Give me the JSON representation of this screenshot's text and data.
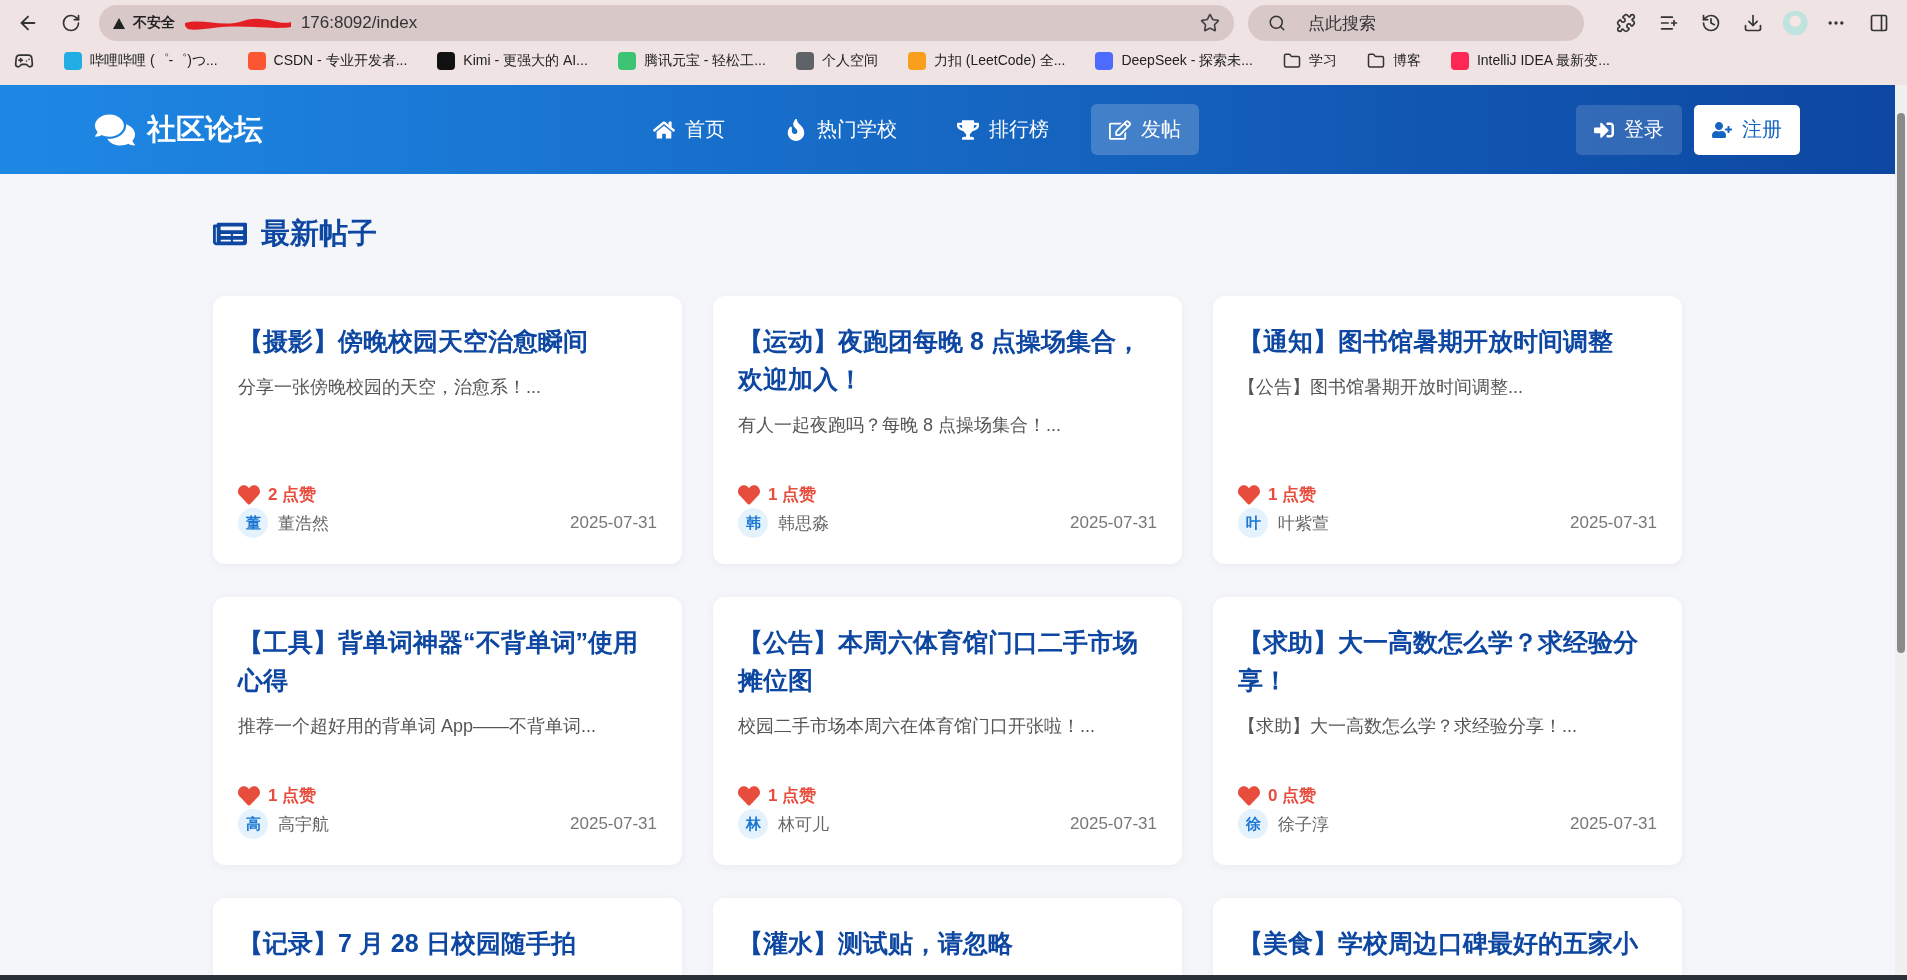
{
  "browser": {
    "security_label": "不安全",
    "url": "176:8092/index",
    "search_placeholder": "点此搜索",
    "bookmarks": [
      {
        "label": "哔哩哔哩 (゜-゜)つ...",
        "kind": "site",
        "color": "#23ade5"
      },
      {
        "label": "CSDN - 专业开发者...",
        "kind": "site",
        "color": "#fc5531"
      },
      {
        "label": "Kimi - 更强大的 AI...",
        "kind": "site",
        "color": "#111111"
      },
      {
        "label": "腾讯元宝 - 轻松工...",
        "kind": "site",
        "color": "#3cc474"
      },
      {
        "label": "个人空间",
        "kind": "site",
        "color": "#5f6368"
      },
      {
        "label": "力扣 (LeetCode) 全...",
        "kind": "site",
        "color": "#f89f1b"
      },
      {
        "label": "DeepSeek - 探索未...",
        "kind": "site",
        "color": "#4d6bfe"
      },
      {
        "label": "学习",
        "kind": "folder"
      },
      {
        "label": "博客",
        "kind": "folder"
      },
      {
        "label": "IntelliJ IDEA 最新变...",
        "kind": "site",
        "color": "#fe2857"
      }
    ]
  },
  "header": {
    "brand": "社区论坛",
    "nav": [
      {
        "label": "首页",
        "selected": false
      },
      {
        "label": "热门学校",
        "selected": false
      },
      {
        "label": "排行榜",
        "selected": false
      },
      {
        "label": "发帖",
        "selected": true
      }
    ],
    "actions": [
      {
        "label": "登录",
        "kind": "ghost"
      },
      {
        "label": "注册",
        "kind": "solid"
      }
    ]
  },
  "section_title": "最新帖子",
  "posts": [
    {
      "title": "【摄影】傍晚校园天空治愈瞬间",
      "excerpt": "分享一张傍晚校园的天空，治愈系！...",
      "likes": "2 点赞",
      "avatar": "董",
      "author": "董浩然",
      "date": "2025-07-31"
    },
    {
      "title": "【运动】夜跑团每晚 8 点操场集合，欢迎加入！",
      "excerpt": "有人一起夜跑吗？每晚 8 点操场集合！...",
      "likes": "1 点赞",
      "avatar": "韩",
      "author": "韩思淼",
      "date": "2025-07-31"
    },
    {
      "title": "【通知】图书馆暑期开放时间调整",
      "excerpt": "【公告】图书馆暑期开放时间调整...",
      "likes": "1 点赞",
      "avatar": "叶",
      "author": "叶紫萱",
      "date": "2025-07-31"
    },
    {
      "title": "【工具】背单词神器“不背单词”使用心得",
      "excerpt": "推荐一个超好用的背单词 App——不背单词...",
      "likes": "1 点赞",
      "avatar": "高",
      "author": "高宇航",
      "date": "2025-07-31"
    },
    {
      "title": "【公告】本周六体育馆门口二手市场摊位图",
      "excerpt": "校园二手市场本周六在体育馆门口开张啦！...",
      "likes": "1 点赞",
      "avatar": "林",
      "author": "林可儿",
      "date": "2025-07-31"
    },
    {
      "title": "【求助】大一高数怎么学？求经验分享！",
      "excerpt": "【求助】大一高数怎么学？求经验分享！...",
      "likes": "0 点赞",
      "avatar": "徐",
      "author": "徐子淳",
      "date": "2025-07-31"
    },
    {
      "title": "【记录】7 月 28 日校园随手拍"
    },
    {
      "title": "【灌水】测试贴，请忽略"
    },
    {
      "title": "【美食】学校周边口碑最好的五家小"
    }
  ]
}
